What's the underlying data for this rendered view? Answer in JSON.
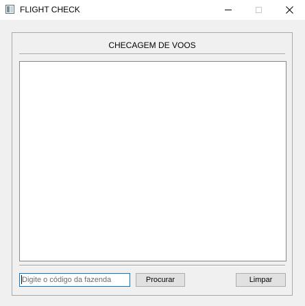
{
  "window": {
    "title": "FLIGHT CHECK",
    "app_icon": "window-app-icon",
    "controls": {
      "minimize_icon": "minimize-icon",
      "maximize_icon": "maximize-icon",
      "close_icon": "close-icon"
    }
  },
  "main": {
    "header": "CHECAGEM DE VOOS",
    "results_items": []
  },
  "search": {
    "value": "",
    "placeholder": "Digite o código da fazenda"
  },
  "buttons": {
    "search_label": "Procurar",
    "clear_label": "Limpar"
  },
  "colors": {
    "window_bg": "#f0f0f0",
    "titlebar_bg": "#ffffff",
    "input_focus_border": "#0078d7",
    "button_bg": "#e1e1e1",
    "button_border": "#adadad"
  }
}
